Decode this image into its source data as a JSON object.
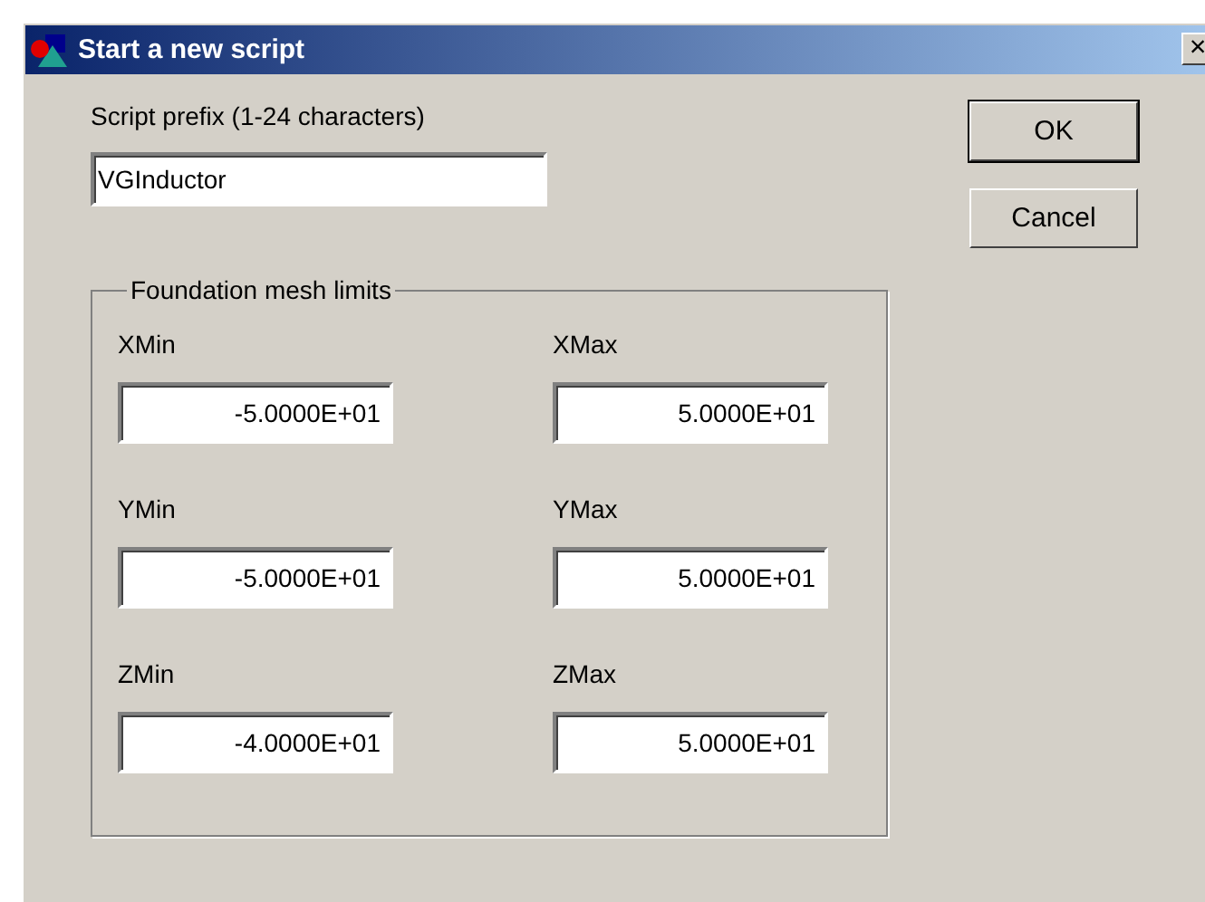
{
  "window": {
    "title": "Start a new script",
    "close_label": "×"
  },
  "prefix": {
    "label": "Script prefix (1-24 characters)",
    "value": "VGInductor"
  },
  "buttons": [
    "OK",
    "Cancel"
  ],
  "group": {
    "title": "Foundation mesh limits",
    "fields": [
      {
        "label": "XMin",
        "value": "-5.0000E+01"
      },
      {
        "label": "XMax",
        "value": "5.0000E+01"
      },
      {
        "label": "YMin",
        "value": "-5.0000E+01"
      },
      {
        "label": "YMax",
        "value": "5.0000E+01"
      },
      {
        "label": "ZMin",
        "value": "-4.0000E+01"
      },
      {
        "label": "ZMax",
        "value": "5.0000E+01"
      }
    ]
  }
}
